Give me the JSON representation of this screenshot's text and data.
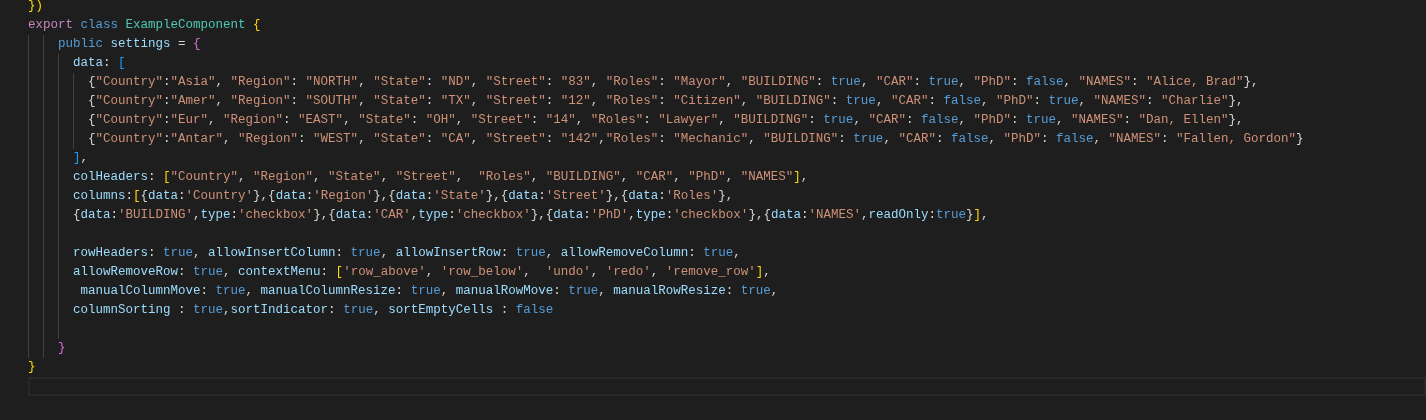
{
  "editor": {
    "lines": [
      {
        "tokens": [
          {
            "kind": "b1",
            "text": "})"
          }
        ]
      },
      {
        "tokens": [
          {
            "kind": "kw",
            "text": "export "
          },
          {
            "kind": "storage",
            "text": "class "
          },
          {
            "kind": "type",
            "text": "ExampleComponent "
          },
          {
            "kind": "b1",
            "text": "{"
          }
        ]
      },
      {
        "tokens": [
          {
            "kind": "storage",
            "text": "    public "
          },
          {
            "kind": "prop",
            "text": "settings"
          },
          {
            "kind": "punc",
            "text": " = "
          },
          {
            "kind": "b2",
            "text": "{"
          }
        ]
      },
      {
        "tokens": [
          {
            "kind": "prop",
            "text": "      data"
          },
          {
            "kind": "punc",
            "text": ": "
          },
          {
            "kind": "b3",
            "text": "["
          }
        ]
      },
      {
        "tokens": [
          {
            "kind": "punc",
            "text": "        {"
          },
          {
            "kind": "str",
            "text": "\"Country\""
          },
          {
            "kind": "punc",
            "text": ":"
          },
          {
            "kind": "str",
            "text": "\"Asia\""
          },
          {
            "kind": "punc",
            "text": ", "
          },
          {
            "kind": "str",
            "text": "\"Region\""
          },
          {
            "kind": "punc",
            "text": ": "
          },
          {
            "kind": "str",
            "text": "\"NORTH\""
          },
          {
            "kind": "punc",
            "text": ", "
          },
          {
            "kind": "str",
            "text": "\"State\""
          },
          {
            "kind": "punc",
            "text": ": "
          },
          {
            "kind": "str",
            "text": "\"ND\""
          },
          {
            "kind": "punc",
            "text": ", "
          },
          {
            "kind": "str",
            "text": "\"Street\""
          },
          {
            "kind": "punc",
            "text": ": "
          },
          {
            "kind": "str",
            "text": "\"83\""
          },
          {
            "kind": "punc",
            "text": ", "
          },
          {
            "kind": "str",
            "text": "\"Roles\""
          },
          {
            "kind": "punc",
            "text": ": "
          },
          {
            "kind": "str",
            "text": "\"Mayor\""
          },
          {
            "kind": "punc",
            "text": ", "
          },
          {
            "kind": "str",
            "text": "\"BUILDING\""
          },
          {
            "kind": "punc",
            "text": ": "
          },
          {
            "kind": "bool",
            "text": "true"
          },
          {
            "kind": "punc",
            "text": ", "
          },
          {
            "kind": "str",
            "text": "\"CAR\""
          },
          {
            "kind": "punc",
            "text": ": "
          },
          {
            "kind": "bool",
            "text": "true"
          },
          {
            "kind": "punc",
            "text": ", "
          },
          {
            "kind": "str",
            "text": "\"PhD\""
          },
          {
            "kind": "punc",
            "text": ": "
          },
          {
            "kind": "bool",
            "text": "false"
          },
          {
            "kind": "punc",
            "text": ", "
          },
          {
            "kind": "str",
            "text": "\"NAMES\""
          },
          {
            "kind": "punc",
            "text": ": "
          },
          {
            "kind": "str",
            "text": "\"Alice, Brad\""
          },
          {
            "kind": "punc",
            "text": "},"
          }
        ]
      },
      {
        "tokens": [
          {
            "kind": "punc",
            "text": "        {"
          },
          {
            "kind": "str",
            "text": "\"Country\""
          },
          {
            "kind": "punc",
            "text": ":"
          },
          {
            "kind": "str",
            "text": "\"Amer\""
          },
          {
            "kind": "punc",
            "text": ", "
          },
          {
            "kind": "str",
            "text": "\"Region\""
          },
          {
            "kind": "punc",
            "text": ": "
          },
          {
            "kind": "str",
            "text": "\"SOUTH\""
          },
          {
            "kind": "punc",
            "text": ", "
          },
          {
            "kind": "str",
            "text": "\"State\""
          },
          {
            "kind": "punc",
            "text": ": "
          },
          {
            "kind": "str",
            "text": "\"TX\""
          },
          {
            "kind": "punc",
            "text": ", "
          },
          {
            "kind": "str",
            "text": "\"Street\""
          },
          {
            "kind": "punc",
            "text": ": "
          },
          {
            "kind": "str",
            "text": "\"12\""
          },
          {
            "kind": "punc",
            "text": ", "
          },
          {
            "kind": "str",
            "text": "\"Roles\""
          },
          {
            "kind": "punc",
            "text": ": "
          },
          {
            "kind": "str",
            "text": "\"Citizen\""
          },
          {
            "kind": "punc",
            "text": ", "
          },
          {
            "kind": "str",
            "text": "\"BUILDING\""
          },
          {
            "kind": "punc",
            "text": ": "
          },
          {
            "kind": "bool",
            "text": "true"
          },
          {
            "kind": "punc",
            "text": ", "
          },
          {
            "kind": "str",
            "text": "\"CAR\""
          },
          {
            "kind": "punc",
            "text": ": "
          },
          {
            "kind": "bool",
            "text": "false"
          },
          {
            "kind": "punc",
            "text": ", "
          },
          {
            "kind": "str",
            "text": "\"PhD\""
          },
          {
            "kind": "punc",
            "text": ": "
          },
          {
            "kind": "bool",
            "text": "true"
          },
          {
            "kind": "punc",
            "text": ", "
          },
          {
            "kind": "str",
            "text": "\"NAMES\""
          },
          {
            "kind": "punc",
            "text": ": "
          },
          {
            "kind": "str",
            "text": "\"Charlie\""
          },
          {
            "kind": "punc",
            "text": "},"
          }
        ]
      },
      {
        "tokens": [
          {
            "kind": "punc",
            "text": "        {"
          },
          {
            "kind": "str",
            "text": "\"Country\""
          },
          {
            "kind": "punc",
            "text": ":"
          },
          {
            "kind": "str",
            "text": "\"Eur\""
          },
          {
            "kind": "punc",
            "text": ", "
          },
          {
            "kind": "str",
            "text": "\"Region\""
          },
          {
            "kind": "punc",
            "text": ": "
          },
          {
            "kind": "str",
            "text": "\"EAST\""
          },
          {
            "kind": "punc",
            "text": ", "
          },
          {
            "kind": "str",
            "text": "\"State\""
          },
          {
            "kind": "punc",
            "text": ": "
          },
          {
            "kind": "str",
            "text": "\"OH\""
          },
          {
            "kind": "punc",
            "text": ", "
          },
          {
            "kind": "str",
            "text": "\"Street\""
          },
          {
            "kind": "punc",
            "text": ": "
          },
          {
            "kind": "str",
            "text": "\"14\""
          },
          {
            "kind": "punc",
            "text": ", "
          },
          {
            "kind": "str",
            "text": "\"Roles\""
          },
          {
            "kind": "punc",
            "text": ": "
          },
          {
            "kind": "str",
            "text": "\"Lawyer\""
          },
          {
            "kind": "punc",
            "text": ", "
          },
          {
            "kind": "str",
            "text": "\"BUILDING\""
          },
          {
            "kind": "punc",
            "text": ": "
          },
          {
            "kind": "bool",
            "text": "true"
          },
          {
            "kind": "punc",
            "text": ", "
          },
          {
            "kind": "str",
            "text": "\"CAR\""
          },
          {
            "kind": "punc",
            "text": ": "
          },
          {
            "kind": "bool",
            "text": "false"
          },
          {
            "kind": "punc",
            "text": ", "
          },
          {
            "kind": "str",
            "text": "\"PhD\""
          },
          {
            "kind": "punc",
            "text": ": "
          },
          {
            "kind": "bool",
            "text": "true"
          },
          {
            "kind": "punc",
            "text": ", "
          },
          {
            "kind": "str",
            "text": "\"NAMES\""
          },
          {
            "kind": "punc",
            "text": ": "
          },
          {
            "kind": "str",
            "text": "\"Dan, Ellen\""
          },
          {
            "kind": "punc",
            "text": "},"
          }
        ]
      },
      {
        "tokens": [
          {
            "kind": "punc",
            "text": "        {"
          },
          {
            "kind": "str",
            "text": "\"Country\""
          },
          {
            "kind": "punc",
            "text": ":"
          },
          {
            "kind": "str",
            "text": "\"Antar\""
          },
          {
            "kind": "punc",
            "text": ", "
          },
          {
            "kind": "str",
            "text": "\"Region\""
          },
          {
            "kind": "punc",
            "text": ": "
          },
          {
            "kind": "str",
            "text": "\"WEST\""
          },
          {
            "kind": "punc",
            "text": ", "
          },
          {
            "kind": "str",
            "text": "\"State\""
          },
          {
            "kind": "punc",
            "text": ": "
          },
          {
            "kind": "str",
            "text": "\"CA\""
          },
          {
            "kind": "punc",
            "text": ", "
          },
          {
            "kind": "str",
            "text": "\"Street\""
          },
          {
            "kind": "punc",
            "text": ": "
          },
          {
            "kind": "str",
            "text": "\"142\""
          },
          {
            "kind": "punc",
            "text": ","
          },
          {
            "kind": "str",
            "text": "\"Roles\""
          },
          {
            "kind": "punc",
            "text": ": "
          },
          {
            "kind": "str",
            "text": "\"Mechanic\""
          },
          {
            "kind": "punc",
            "text": ", "
          },
          {
            "kind": "str",
            "text": "\"BUILDING\""
          },
          {
            "kind": "punc",
            "text": ": "
          },
          {
            "kind": "bool",
            "text": "true"
          },
          {
            "kind": "punc",
            "text": ", "
          },
          {
            "kind": "str",
            "text": "\"CAR\""
          },
          {
            "kind": "punc",
            "text": ": "
          },
          {
            "kind": "bool",
            "text": "false"
          },
          {
            "kind": "punc",
            "text": ", "
          },
          {
            "kind": "str",
            "text": "\"PhD\""
          },
          {
            "kind": "punc",
            "text": ": "
          },
          {
            "kind": "bool",
            "text": "false"
          },
          {
            "kind": "punc",
            "text": ", "
          },
          {
            "kind": "str",
            "text": "\"NAMES\""
          },
          {
            "kind": "punc",
            "text": ": "
          },
          {
            "kind": "str",
            "text": "\"Fallen, Gordon\""
          },
          {
            "kind": "punc",
            "text": "}"
          }
        ]
      },
      {
        "tokens": [
          {
            "kind": "b3",
            "text": "      ]"
          },
          {
            "kind": "punc",
            "text": ","
          }
        ]
      },
      {
        "tokens": [
          {
            "kind": "prop",
            "text": "      colHeaders"
          },
          {
            "kind": "punc",
            "text": ": "
          },
          {
            "kind": "b1",
            "text": "["
          },
          {
            "kind": "str",
            "text": "\"Country\""
          },
          {
            "kind": "punc",
            "text": ", "
          },
          {
            "kind": "str",
            "text": "\"Region\""
          },
          {
            "kind": "punc",
            "text": ", "
          },
          {
            "kind": "str",
            "text": "\"State\""
          },
          {
            "kind": "punc",
            "text": ", "
          },
          {
            "kind": "str",
            "text": "\"Street\""
          },
          {
            "kind": "punc",
            "text": ",  "
          },
          {
            "kind": "str",
            "text": "\"Roles\""
          },
          {
            "kind": "punc",
            "text": ", "
          },
          {
            "kind": "str",
            "text": "\"BUILDING\""
          },
          {
            "kind": "punc",
            "text": ", "
          },
          {
            "kind": "str",
            "text": "\"CAR\""
          },
          {
            "kind": "punc",
            "text": ", "
          },
          {
            "kind": "str",
            "text": "\"PhD\""
          },
          {
            "kind": "punc",
            "text": ", "
          },
          {
            "kind": "str",
            "text": "\"NAMES\""
          },
          {
            "kind": "b1",
            "text": "]"
          },
          {
            "kind": "punc",
            "text": ","
          }
        ]
      },
      {
        "tokens": [
          {
            "kind": "prop",
            "text": "      columns"
          },
          {
            "kind": "punc",
            "text": ":"
          },
          {
            "kind": "b1",
            "text": "["
          },
          {
            "kind": "punc",
            "text": "{"
          },
          {
            "kind": "prop",
            "text": "data"
          },
          {
            "kind": "punc",
            "text": ":"
          },
          {
            "kind": "str",
            "text": "'Country'"
          },
          {
            "kind": "punc",
            "text": "},{"
          },
          {
            "kind": "prop",
            "text": "data"
          },
          {
            "kind": "punc",
            "text": ":"
          },
          {
            "kind": "str",
            "text": "'Region'"
          },
          {
            "kind": "punc",
            "text": "},{"
          },
          {
            "kind": "prop",
            "text": "data"
          },
          {
            "kind": "punc",
            "text": ":"
          },
          {
            "kind": "str",
            "text": "'State'"
          },
          {
            "kind": "punc",
            "text": "},{"
          },
          {
            "kind": "prop",
            "text": "data"
          },
          {
            "kind": "punc",
            "text": ":"
          },
          {
            "kind": "str",
            "text": "'Street'"
          },
          {
            "kind": "punc",
            "text": "},{"
          },
          {
            "kind": "prop",
            "text": "data"
          },
          {
            "kind": "punc",
            "text": ":"
          },
          {
            "kind": "str",
            "text": "'Roles'"
          },
          {
            "kind": "punc",
            "text": "},"
          }
        ]
      },
      {
        "tokens": [
          {
            "kind": "punc",
            "text": "      {"
          },
          {
            "kind": "prop",
            "text": "data"
          },
          {
            "kind": "punc",
            "text": ":"
          },
          {
            "kind": "str",
            "text": "'BUILDING'"
          },
          {
            "kind": "punc",
            "text": ","
          },
          {
            "kind": "prop",
            "text": "type"
          },
          {
            "kind": "punc",
            "text": ":"
          },
          {
            "kind": "str",
            "text": "'checkbox'"
          },
          {
            "kind": "punc",
            "text": "},{"
          },
          {
            "kind": "prop",
            "text": "data"
          },
          {
            "kind": "punc",
            "text": ":"
          },
          {
            "kind": "str",
            "text": "'CAR'"
          },
          {
            "kind": "punc",
            "text": ","
          },
          {
            "kind": "prop",
            "text": "type"
          },
          {
            "kind": "punc",
            "text": ":"
          },
          {
            "kind": "str",
            "text": "'checkbox'"
          },
          {
            "kind": "punc",
            "text": "},{"
          },
          {
            "kind": "prop",
            "text": "data"
          },
          {
            "kind": "punc",
            "text": ":"
          },
          {
            "kind": "str",
            "text": "'PhD'"
          },
          {
            "kind": "punc",
            "text": ","
          },
          {
            "kind": "prop",
            "text": "type"
          },
          {
            "kind": "punc",
            "text": ":"
          },
          {
            "kind": "str",
            "text": "'checkbox'"
          },
          {
            "kind": "punc",
            "text": "},{"
          },
          {
            "kind": "prop",
            "text": "data"
          },
          {
            "kind": "punc",
            "text": ":"
          },
          {
            "kind": "str",
            "text": "'NAMES'"
          },
          {
            "kind": "punc",
            "text": ","
          },
          {
            "kind": "prop",
            "text": "readOnly"
          },
          {
            "kind": "punc",
            "text": ":"
          },
          {
            "kind": "bool",
            "text": "true"
          },
          {
            "kind": "punc",
            "text": "}"
          },
          {
            "kind": "b1",
            "text": "]"
          },
          {
            "kind": "punc",
            "text": ","
          }
        ]
      },
      {
        "kind": "blank"
      },
      {
        "tokens": [
          {
            "kind": "prop",
            "text": "      rowHeaders"
          },
          {
            "kind": "punc",
            "text": ": "
          },
          {
            "kind": "bool",
            "text": "true"
          },
          {
            "kind": "punc",
            "text": ", "
          },
          {
            "kind": "prop",
            "text": "allowInsertColumn"
          },
          {
            "kind": "punc",
            "text": ": "
          },
          {
            "kind": "bool",
            "text": "true"
          },
          {
            "kind": "punc",
            "text": ", "
          },
          {
            "kind": "prop",
            "text": "allowInsertRow"
          },
          {
            "kind": "punc",
            "text": ": "
          },
          {
            "kind": "bool",
            "text": "true"
          },
          {
            "kind": "punc",
            "text": ", "
          },
          {
            "kind": "prop",
            "text": "allowRemoveColumn"
          },
          {
            "kind": "punc",
            "text": ": "
          },
          {
            "kind": "bool",
            "text": "true"
          },
          {
            "kind": "punc",
            "text": ","
          }
        ]
      },
      {
        "tokens": [
          {
            "kind": "prop",
            "text": "      allowRemoveRow"
          },
          {
            "kind": "punc",
            "text": ": "
          },
          {
            "kind": "bool",
            "text": "true"
          },
          {
            "kind": "punc",
            "text": ", "
          },
          {
            "kind": "prop",
            "text": "contextMenu"
          },
          {
            "kind": "punc",
            "text": ": "
          },
          {
            "kind": "b1",
            "text": "["
          },
          {
            "kind": "str",
            "text": "'row_above'"
          },
          {
            "kind": "punc",
            "text": ", "
          },
          {
            "kind": "str",
            "text": "'row_below'"
          },
          {
            "kind": "punc",
            "text": ",  "
          },
          {
            "kind": "str",
            "text": "'undo'"
          },
          {
            "kind": "punc",
            "text": ", "
          },
          {
            "kind": "str",
            "text": "'redo'"
          },
          {
            "kind": "punc",
            "text": ", "
          },
          {
            "kind": "str",
            "text": "'remove_row'"
          },
          {
            "kind": "b1",
            "text": "]"
          },
          {
            "kind": "punc",
            "text": ","
          }
        ]
      },
      {
        "tokens": [
          {
            "kind": "prop",
            "text": "       manualColumnMove"
          },
          {
            "kind": "punc",
            "text": ": "
          },
          {
            "kind": "bool",
            "text": "true"
          },
          {
            "kind": "punc",
            "text": ", "
          },
          {
            "kind": "prop",
            "text": "manualColumnResize"
          },
          {
            "kind": "punc",
            "text": ": "
          },
          {
            "kind": "bool",
            "text": "true"
          },
          {
            "kind": "punc",
            "text": ", "
          },
          {
            "kind": "prop",
            "text": "manualRowMove"
          },
          {
            "kind": "punc",
            "text": ": "
          },
          {
            "kind": "bool",
            "text": "true"
          },
          {
            "kind": "punc",
            "text": ", "
          },
          {
            "kind": "prop",
            "text": "manualRowResize"
          },
          {
            "kind": "punc",
            "text": ": "
          },
          {
            "kind": "bool",
            "text": "true"
          },
          {
            "kind": "punc",
            "text": ","
          }
        ]
      },
      {
        "tokens": [
          {
            "kind": "prop",
            "text": "      columnSorting"
          },
          {
            "kind": "punc",
            "text": " : "
          },
          {
            "kind": "bool",
            "text": "true"
          },
          {
            "kind": "punc",
            "text": ","
          },
          {
            "kind": "prop",
            "text": "sortIndicator"
          },
          {
            "kind": "punc",
            "text": ": "
          },
          {
            "kind": "bool",
            "text": "true"
          },
          {
            "kind": "punc",
            "text": ", "
          },
          {
            "kind": "prop",
            "text": "sortEmptyCells"
          },
          {
            "kind": "punc",
            "text": " : "
          },
          {
            "kind": "bool",
            "text": "false"
          }
        ]
      },
      {
        "kind": "blank"
      },
      {
        "tokens": [
          {
            "kind": "b2",
            "text": "    }"
          }
        ]
      },
      {
        "tokens": [
          {
            "kind": "b1",
            "text": "}"
          }
        ]
      },
      {
        "kind": "cursor-line"
      }
    ]
  }
}
